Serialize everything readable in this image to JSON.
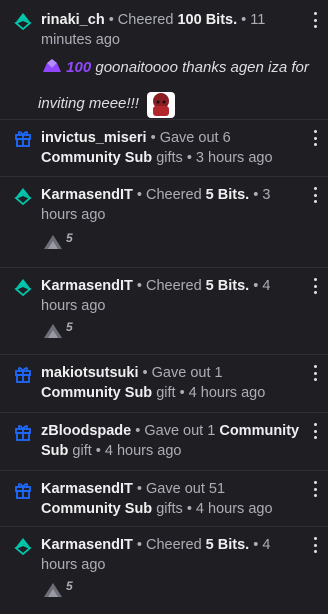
{
  "colors": {
    "bits_green": "#00c8af",
    "gift_blue": "#1f69ff",
    "bits_purple": "#9147ff"
  },
  "feed": [
    {
      "type": "cheer",
      "icon": "bits-icon",
      "user": "rinaki_ch",
      "pre": " • Cheered ",
      "amount": "100 Bits.",
      "post": " • 11 minutes ago",
      "message": {
        "bits": "100",
        "text": " goonaitoooo thanks agen iza for inviting meee!!!"
      }
    },
    {
      "type": "gift",
      "icon": "gift-icon",
      "user": "invictus_miseri",
      "pre": " • Gave out 6 ",
      "amount": "Community Sub",
      "post": " gifts • 3 hours ago"
    },
    {
      "type": "cheer",
      "icon": "bits-icon",
      "user": "KarmasendIT",
      "pre": " • Cheered ",
      "amount": "5 Bits.",
      "post": " • 3 hours ago",
      "cheermote_amount": "5"
    },
    {
      "type": "cheer",
      "icon": "bits-icon",
      "user": "KarmasendIT",
      "pre": " • Cheered ",
      "amount": "5 Bits.",
      "post": " • 4 hours ago",
      "cheermote_amount": "5"
    },
    {
      "type": "gift",
      "icon": "gift-icon",
      "user": "makiotsutsuki",
      "pre": " • Gave out 1 ",
      "amount": "Community Sub",
      "post": " gift • 4 hours ago"
    },
    {
      "type": "gift",
      "icon": "gift-icon",
      "user": "zBloodspade",
      "pre": " • Gave out 1 ",
      "amount": "Community Sub",
      "post": " gift • 4 hours ago"
    },
    {
      "type": "gift",
      "icon": "gift-icon",
      "user": "KarmasendIT",
      "pre": " • Gave out 51 ",
      "amount": "Community Sub",
      "post": " gifts • 4 hours ago"
    },
    {
      "type": "cheer",
      "icon": "bits-icon",
      "user": "KarmasendIT",
      "pre": " • Cheered ",
      "amount": "5 Bits.",
      "post": " • 4 hours ago",
      "cheermote_amount": "5"
    }
  ]
}
